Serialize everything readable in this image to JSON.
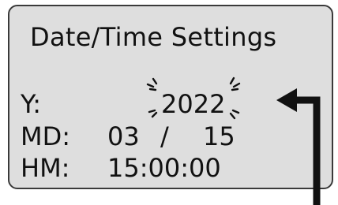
{
  "screen": {
    "title": "Date/Time Settings",
    "year": {
      "label": "Y:",
      "value": "2022",
      "editing": true
    },
    "month_day": {
      "label": "MD:",
      "month": "03",
      "separator": "/",
      "day": "15"
    },
    "hour_minute": {
      "label": "HM:",
      "time": "15:00:00"
    }
  },
  "colors": {
    "screen_bg": "#dedede",
    "text": "#111111",
    "arrow": "#111111"
  },
  "icons": {
    "blink_indicator": "blink-marks-icon",
    "pointer_arrow": "arrow-pointer-icon"
  }
}
